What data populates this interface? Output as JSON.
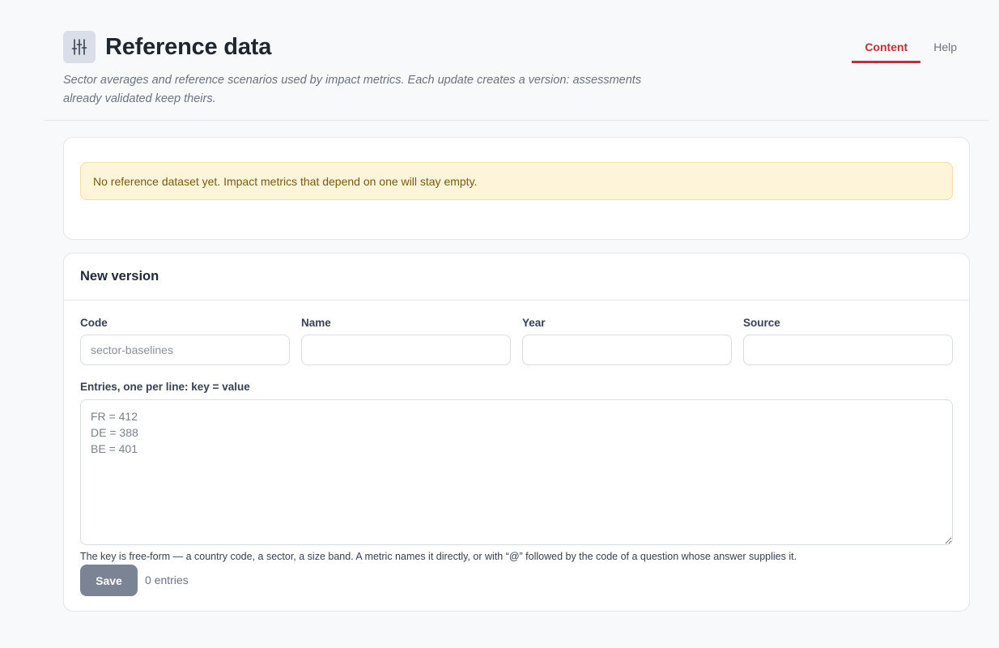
{
  "header": {
    "title": "Reference data",
    "icon": "sliders-icon",
    "subtitle": "Sector averages and reference scenarios used by impact metrics. Each update creates a version: assessments already validated keep theirs."
  },
  "tabs": [
    {
      "label": "Content",
      "active": true
    },
    {
      "label": "Help",
      "active": false
    }
  ],
  "alert": {
    "text": "No reference dataset yet. Impact metrics that depend on one will stay empty."
  },
  "new_version": {
    "title": "New version",
    "fields": {
      "code": {
        "label": "Code",
        "value": "",
        "placeholder": "sector-baselines"
      },
      "name": {
        "label": "Name",
        "value": "",
        "placeholder": ""
      },
      "year": {
        "label": "Year",
        "value": "",
        "placeholder": ""
      },
      "source": {
        "label": "Source",
        "value": "",
        "placeholder": ""
      }
    },
    "entries": {
      "label": "Entries, one per line: key = value",
      "value": "",
      "placeholder": "FR = 412\nDE = 388\nBE = 401"
    },
    "hint": "The key is free-form — a country code, a sector, a size band. A metric names it directly, or with “@” followed by the code of a question whose answer supplies it.",
    "save_label": "Save",
    "count_text": "0 entries"
  },
  "colors": {
    "accent": "#c0303a",
    "alert_bg": "#fdf4d9",
    "save_button": "#7b8494"
  }
}
